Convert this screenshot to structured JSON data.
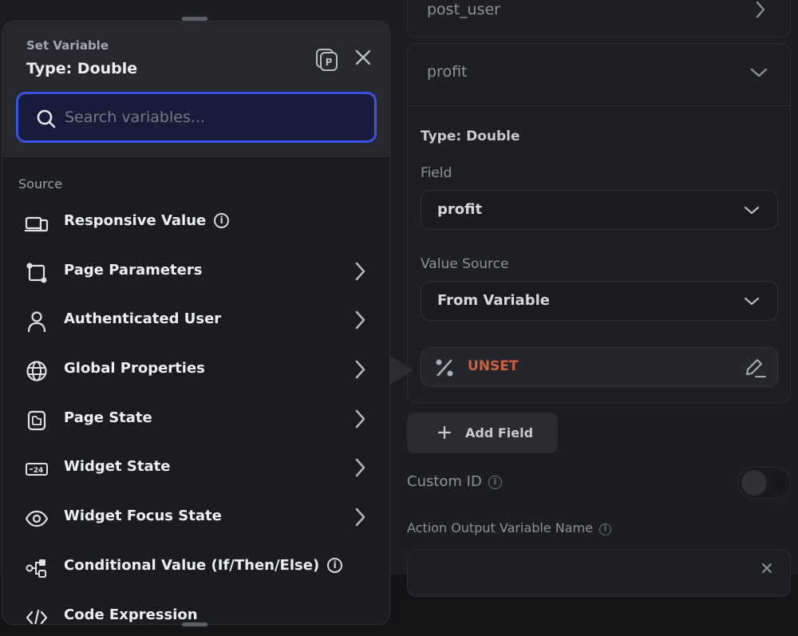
{
  "right_panel": {
    "post_user_label": "post_user",
    "profit_label": "profit",
    "type_label": "Type: Double",
    "field_label": "Field",
    "field_value": "profit",
    "value_source_label": "Value Source",
    "value_source_value": "From Variable",
    "unset_label": "UNSET",
    "add_field_label": "Add Field",
    "custom_id_label": "Custom ID",
    "action_output_label": "Action Output Variable Name",
    "unset_color": "#c8613f"
  },
  "popup": {
    "title_small": "Set Variable",
    "title_large": "Type: Double",
    "search_placeholder": "Search variables...",
    "source_label": "Source",
    "accent_color": "#3b52e8",
    "items": [
      {
        "label": "Responsive Value",
        "icon": "devices-icon",
        "info": true,
        "chevron": false
      },
      {
        "label": "Page Parameters",
        "icon": "nodes-icon",
        "info": false,
        "chevron": true
      },
      {
        "label": "Authenticated User",
        "icon": "user-icon",
        "info": false,
        "chevron": true
      },
      {
        "label": "Global Properties",
        "icon": "globe-icon",
        "info": false,
        "chevron": true
      },
      {
        "label": "Page State",
        "icon": "page-state-icon",
        "info": false,
        "chevron": true
      },
      {
        "label": "Widget State",
        "icon": "widget-state-icon",
        "info": false,
        "chevron": true
      },
      {
        "label": "Widget Focus State",
        "icon": "eye-icon",
        "info": false,
        "chevron": true
      },
      {
        "label": "Conditional Value (If/Then/Else)",
        "icon": "conditional-icon",
        "info": true,
        "chevron": false
      },
      {
        "label": "Code Expression",
        "icon": "code-icon",
        "info": false,
        "chevron": false
      }
    ]
  }
}
